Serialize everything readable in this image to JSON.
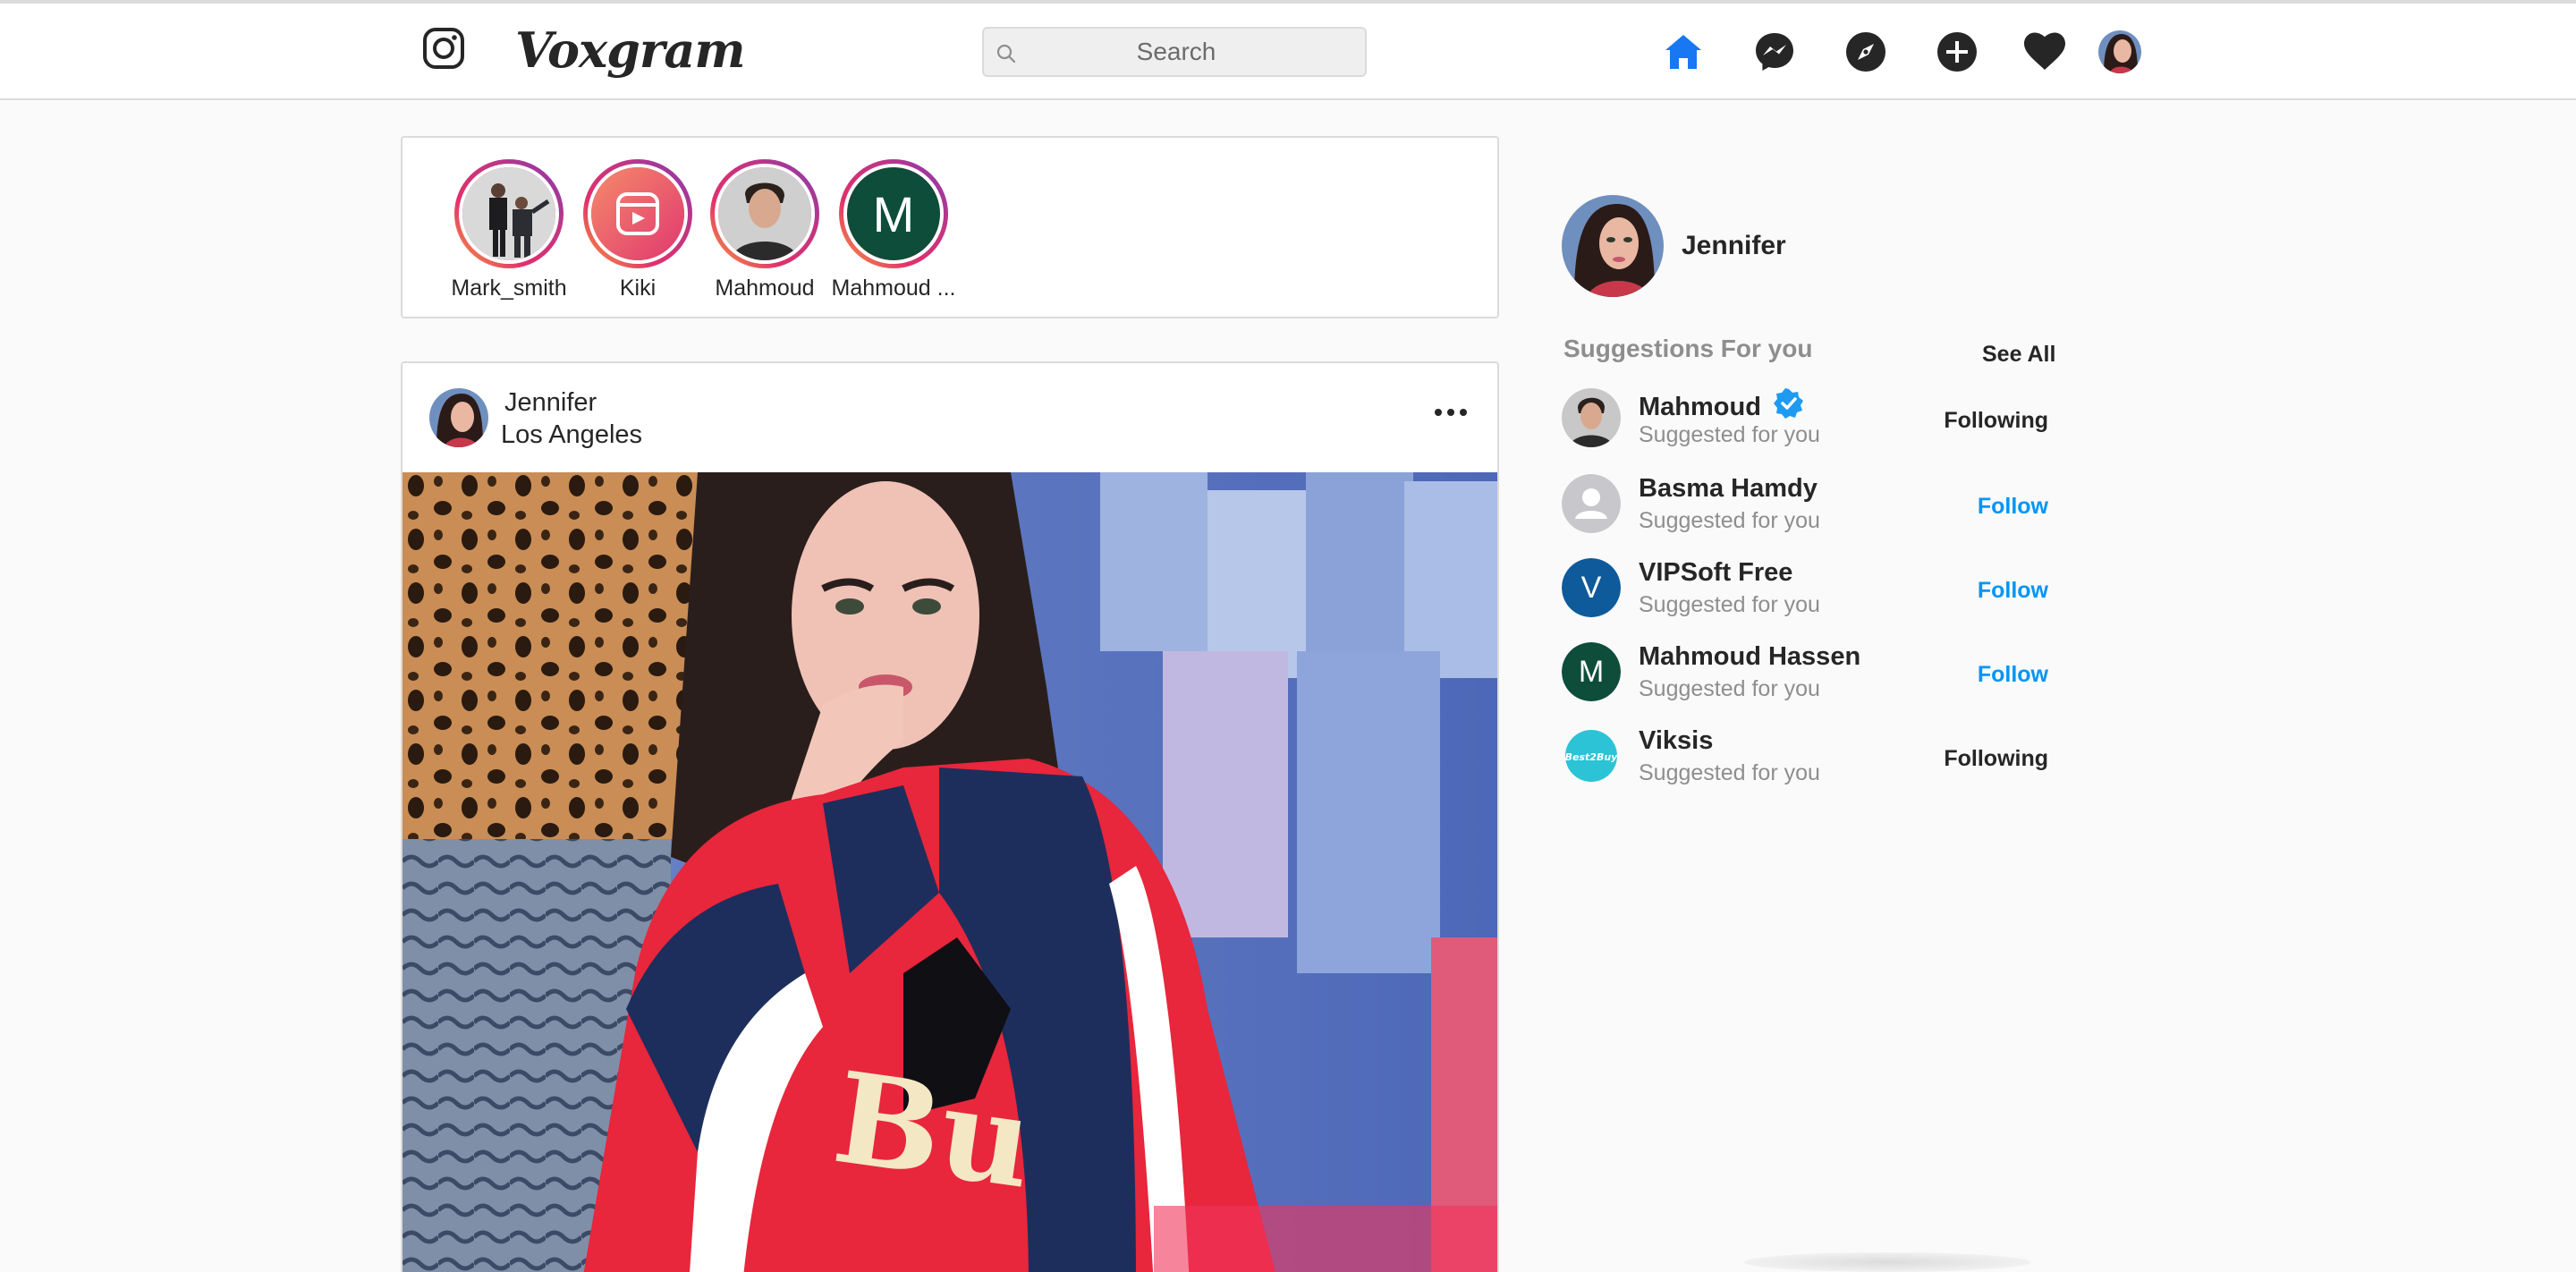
{
  "app": {
    "name": "Voxgram",
    "accent": "#0095f6",
    "home_active_color": "#1877f2"
  },
  "header": {
    "search_placeholder": "Search",
    "nav_icons": [
      "home-icon",
      "messenger-icon",
      "explore-icon",
      "new-post-icon",
      "activity-heart-icon",
      "profile-avatar"
    ]
  },
  "stories": [
    {
      "label": "Mark_smith"
    },
    {
      "label": "Kiki"
    },
    {
      "label": "Mahmoud"
    },
    {
      "label": "Mahmoud ...",
      "letter": "M",
      "color": "#0d4d3a"
    }
  ],
  "post": {
    "user": "Jennifer",
    "location": "Los Angeles"
  },
  "sidebar": {
    "me": {
      "name": "Jennifer"
    },
    "suggestions_title": "Suggestions For you",
    "see_all": "See All",
    "suggestions": [
      {
        "name": "Mahmoud",
        "sub": "Suggested for you",
        "action": "Following",
        "verified": true
      },
      {
        "name": "Basma Hamdy",
        "sub": "Suggested for you",
        "action": "Follow"
      },
      {
        "name": "VIPSoft Free",
        "sub": "Suggested for you",
        "action": "Follow",
        "letter": "V",
        "color": "#0e5a9a"
      },
      {
        "name": "Mahmoud Hassen",
        "sub": "Suggested for you",
        "action": "Follow",
        "letter": "M",
        "color": "#0d4d3a"
      },
      {
        "name": "Viksis",
        "sub": "Suggested for you",
        "action": "Following",
        "logo_text": "Best2Buy",
        "color": "#2cc3d6"
      }
    ]
  }
}
